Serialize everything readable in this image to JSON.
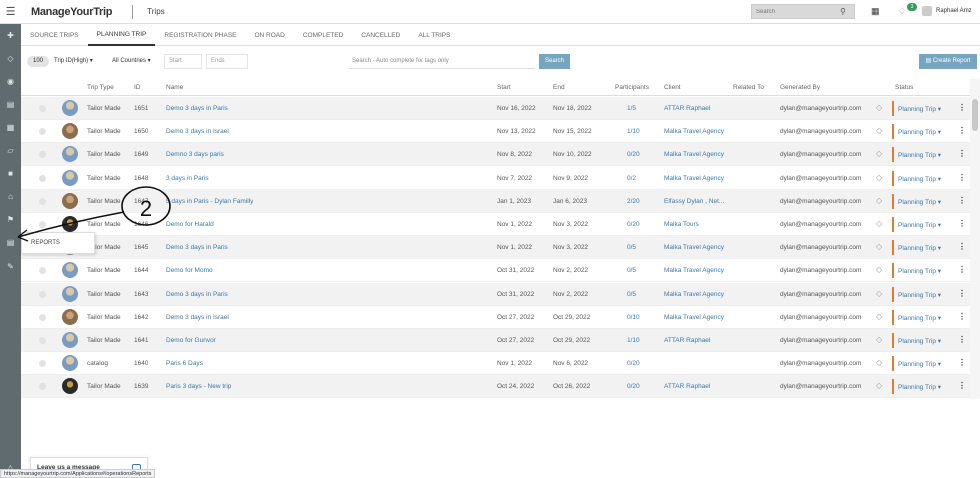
{
  "header": {
    "logo": "ManageYourTrip",
    "title": "Trips",
    "search_placeholder": "Search",
    "notifications_count": "3",
    "user_name": "Raphael Amz"
  },
  "sidebar": {
    "icons": [
      "plus-icon",
      "tag-icon",
      "globe-icon",
      "list-icon",
      "calendar-icon",
      "box-icon",
      "building-icon",
      "home-icon",
      "flag-icon",
      "reports-icon",
      "tools-icon"
    ]
  },
  "reports_popup": "REPORTS",
  "tabs": [
    "SOURCE TRIPS",
    "PLANNING TRIP",
    "REGISTRATION PHASE",
    "ON ROAD",
    "COMPLETED",
    "CANCELLED",
    "ALL TRIPS"
  ],
  "filters": {
    "count": "100",
    "sort": "Trip ID(High)",
    "countries": "All Countries",
    "start_placeholder": "Start",
    "ends_placeholder": "Ends",
    "tag_search_placeholder": "Search - Auto complete for tags only",
    "search_button": "Search",
    "create_report_button": "Create Report"
  },
  "table": {
    "headers": [
      "Trip Type",
      "ID",
      "Name",
      "Start",
      "End",
      "Participants",
      "Client",
      "Related To",
      "Generated By",
      "Status"
    ],
    "rows": [
      {
        "type": "Tailor Made",
        "id": "1651",
        "name": "Demo 3 days in Paris",
        "start": "Nov 16, 2022",
        "end": "Nov 18, 2022",
        "participants": "1/5",
        "client": "ATTAR Raphael",
        "generated_by": "dylan@manageyourtrip.com",
        "status": "Planning Trip",
        "thumb": "blue"
      },
      {
        "type": "Tailor Made",
        "id": "1650",
        "name": "Demo 3 days in Israel",
        "start": "Nov 13, 2022",
        "end": "Nov 15, 2022",
        "participants": "1/10",
        "client": "Malka Travel Agency",
        "generated_by": "dylan@manageyourtrip.com",
        "status": "Planning Trip",
        "thumb": "dark"
      },
      {
        "type": "Tailor Made",
        "id": "1649",
        "name": "Demno 3 days paris",
        "start": "Nov 8, 2022",
        "end": "Nov 10, 2022",
        "participants": "0/20",
        "client": "Malka Travel Agency",
        "generated_by": "dylan@manageyourtrip.com",
        "status": "Planning Trip",
        "thumb": "blue"
      },
      {
        "type": "Tailor Made",
        "id": "1648",
        "name": "3 days in Paris",
        "start": "Nov 7, 2022",
        "end": "Nov 9, 2022",
        "participants": "0/2",
        "client": "Malka Travel Agency",
        "generated_by": "dylan@manageyourtrip.com",
        "status": "Planning Trip",
        "thumb": "blue"
      },
      {
        "type": "Tailor Made",
        "id": "1647",
        "name": "5 days in Paris - Dylan Familly",
        "start": "Jan 1, 2023",
        "end": "Jan 6, 2023",
        "participants": "2/20",
        "client": "Elfassy Dylan , Net...",
        "generated_by": "dylan@manageyourtrip.com",
        "status": "Planning Trip",
        "thumb": "dark"
      },
      {
        "type": "Tailor Made",
        "id": "1646",
        "name": "Demo for Harald",
        "start": "Nov 1, 2022",
        "end": "Nov 3, 2022",
        "participants": "0/20",
        "client": "Malka Tours",
        "generated_by": "dylan@manageyourtrip.com",
        "status": "Planning Trip",
        "thumb": "black"
      },
      {
        "type": "Tailor Made",
        "id": "1645",
        "name": "Demo 3 days in Paris",
        "start": "Nov 1, 2022",
        "end": "Nov 3, 2022",
        "participants": "0/5",
        "client": "Malka Travel Agency",
        "generated_by": "dylan@manageyourtrip.com",
        "status": "Planning Trip",
        "thumb": "blue"
      },
      {
        "type": "Tailor Made",
        "id": "1644",
        "name": "Demo for Momo",
        "start": "Oct 31, 2022",
        "end": "Nov 2, 2022",
        "participants": "0/5",
        "client": "Malka Travel Agency",
        "generated_by": "dylan@manageyourtrip.com",
        "status": "Planning Trip",
        "thumb": "blue"
      },
      {
        "type": "Tailor Made",
        "id": "1643",
        "name": "Demo 3 days in Paris",
        "start": "Oct 31, 2022",
        "end": "Nov 2, 2022",
        "participants": "0/5",
        "client": "Malka Travel Agency",
        "generated_by": "dylan@manageyourtrip.com",
        "status": "Planning Trip",
        "thumb": "blue"
      },
      {
        "type": "Tailor Made",
        "id": "1642",
        "name": "Demo 3 days in Israel",
        "start": "Oct 27, 2022",
        "end": "Oct 29, 2022",
        "participants": "0/10",
        "client": "Malka Travel Agency",
        "generated_by": "dylan@manageyourtrip.com",
        "status": "Planning Trip",
        "thumb": "dark"
      },
      {
        "type": "Tailor Made",
        "id": "1641",
        "name": "Demo for Gunvor",
        "start": "Oct 27, 2022",
        "end": "Oct 29, 2022",
        "participants": "1/10",
        "client": "ATTAR Raphael",
        "generated_by": "dylan@manageyourtrip.com",
        "status": "Planning Trip",
        "thumb": "blue"
      },
      {
        "type": "catalog",
        "id": "1640",
        "name": "Paris 6 Days",
        "start": "Nov 1, 2022",
        "end": "Nov 6, 2022",
        "participants": "0/20",
        "client": "",
        "generated_by": "dylan@manageyourtrip.com",
        "status": "Planning Trip",
        "thumb": "blue"
      },
      {
        "type": "Tailor Made",
        "id": "1639",
        "name": "Paris 3 days - New trip",
        "start": "Oct 24, 2022",
        "end": "Oct 26, 2022",
        "participants": "0/20",
        "client": "ATTAR Raphael",
        "generated_by": "dylan@manageyourtrip.com",
        "status": "Planning Trip",
        "thumb": "black"
      }
    ]
  },
  "annotation": "2",
  "chat": "Leave us a message",
  "status_url": "https://manageyourtrip.com/Applications#/operationsReports",
  "colors": {
    "sidebar": "#5f6b6f",
    "accent_button": "#76a5c3",
    "link": "#3b78a8",
    "status_bar": "#e47a2e"
  }
}
